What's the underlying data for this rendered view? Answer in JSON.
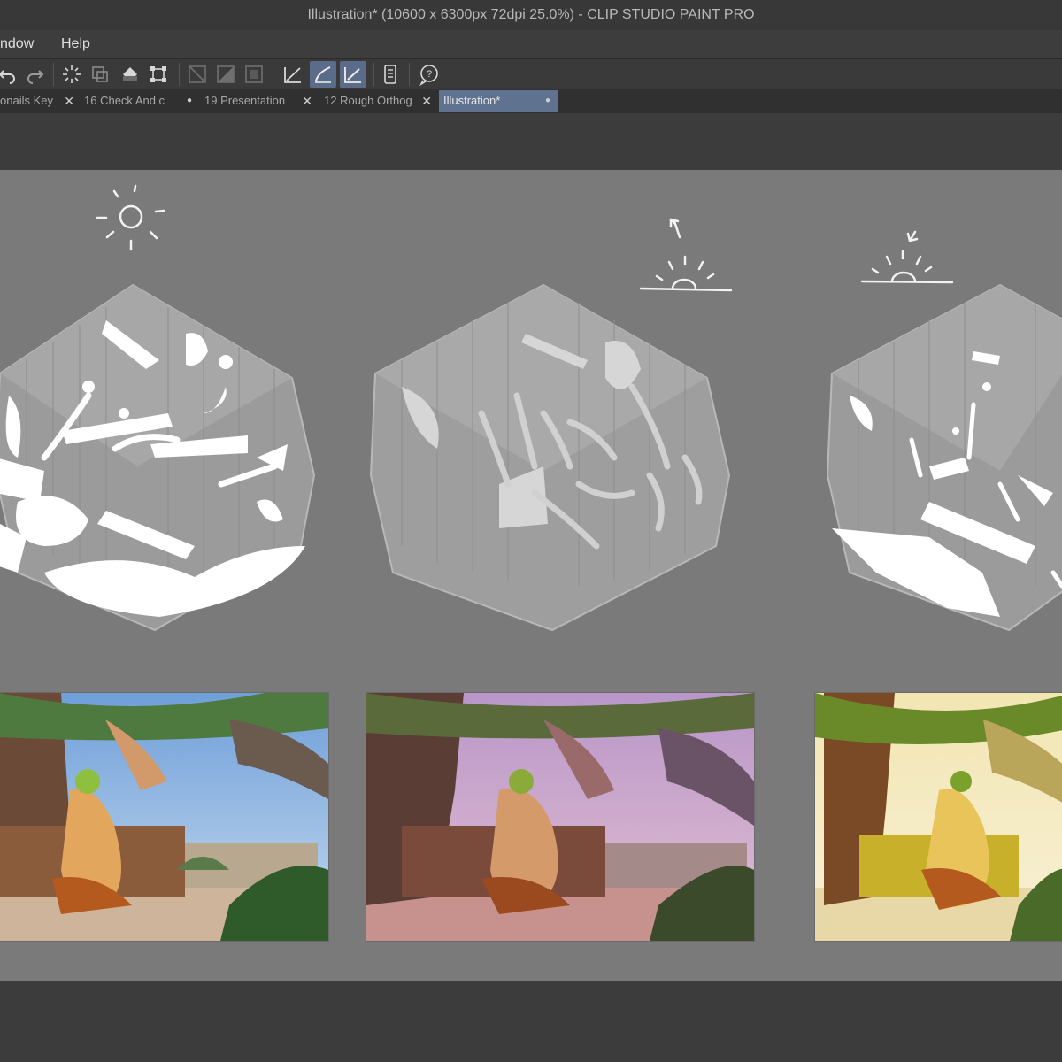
{
  "window": {
    "title": "Illustration* (10600 x 6300px 72dpi 25.0%)  - CLIP STUDIO PAINT PRO"
  },
  "menu": {
    "items": [
      "ndow",
      "Help"
    ]
  },
  "toolbar": {
    "icons": [
      "undo-icon",
      "redo-icon",
      "select-all-icon",
      "transform-icon",
      "fill-icon",
      "crop-icon",
      "ruler-snap-icon",
      "tone-icon",
      "frame-icon",
      "perspective-icon",
      "brush-stabilizer-icon",
      "brush-pressure-icon",
      "document-icon",
      "help-icon"
    ]
  },
  "tabs": [
    {
      "label": "onails Key",
      "close": "✕"
    },
    {
      "label": "16 Check And cl",
      "close": "●"
    },
    {
      "label": "19 Presentation",
      "close": "✕"
    },
    {
      "label": "12 Rough Orthog",
      "close": "✕"
    },
    {
      "label": "Illustration*",
      "close": "●"
    }
  ],
  "canvas": {
    "background": "#7a7a7a",
    "scenes": [
      "midday-lighting-study",
      "sunrise-lighting-study",
      "sunset-lighting-study"
    ],
    "renders": [
      "midday-render",
      "dusk-render",
      "golden-hour-render"
    ]
  },
  "colors": {
    "tab_active": "#5f7290",
    "panel_dark": "#3c3c3c",
    "sky_blue": "#8fb6e3",
    "sky_pink": "#c9a3c9",
    "sky_gold": "#f4e9b0"
  }
}
